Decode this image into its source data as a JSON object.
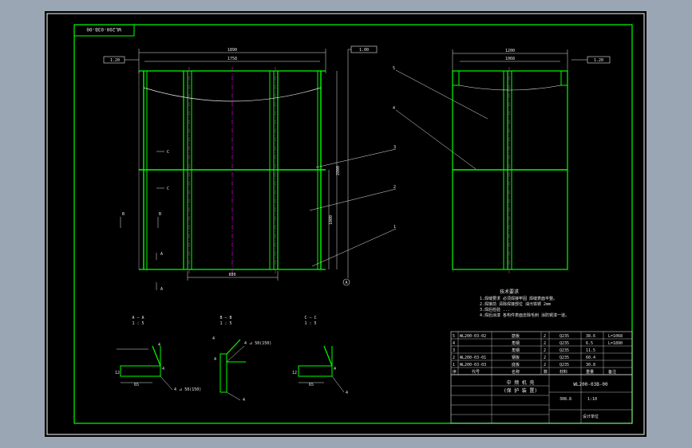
{
  "drawing": {
    "corner_code": "WL200-03B-00",
    "views": {
      "front": {
        "overall_width": "1890",
        "inner_width": "1758",
        "height": "2800",
        "lower_height": "1000",
        "bottom_width": "880",
        "flatness_left": "1.20",
        "flatness_right": "1.00",
        "datum": "A",
        "datum_circle": "A",
        "section_marks": [
          "C",
          "C",
          "B",
          "B",
          "A",
          "A"
        ]
      },
      "side": {
        "overall_width": "1200",
        "inner_width": "1068",
        "flatness": "1.20",
        "datum": "A"
      }
    },
    "leaders": [
      "5",
      "4",
      "3",
      "2",
      "1"
    ],
    "sections": [
      {
        "title": "A — A",
        "scale": "1 : 5",
        "dim1": "65",
        "dim2": "12",
        "dim3": "4",
        "weld": "4 ⊿ 50(150)",
        "extra": "4"
      },
      {
        "title": "B — B",
        "scale": "1 : 5",
        "weld": "4 ⊿ 50(150)",
        "dim1": "4",
        "dim2": "4",
        "extra": "4"
      },
      {
        "title": "C — C",
        "scale": "1 : 5",
        "dim1": "65",
        "dim2": "12",
        "dim3": "4",
        "extra": "4"
      }
    ],
    "notes": {
      "title": "技术要求",
      "lines": [
        "1.焊缝要求 必须焊接牢固 焊缝表面平整。",
        "2.焊接前 清除焊接部位 油污铁锈 2mm",
        "3.焊后检验 ...",
        "4.焊后涂漆 各构件表面去除毛刺 涂防锈漆一道。"
      ]
    },
    "bom": {
      "rows": [
        {
          "no": "5",
          "code": "WL200-03-02",
          "name": "筋板",
          "qty": "2",
          "material": "Q235",
          "weight": "38.6",
          "remark": "L=1068"
        },
        {
          "no": "4",
          "code": "",
          "name": "角钢",
          "qty": "2",
          "material": "Q235",
          "weight": "6.5",
          "remark": "L=1890"
        },
        {
          "no": "3",
          "code": "",
          "name": "角钢",
          "qty": "2",
          "material": "Q235",
          "weight": "11.5",
          "remark": ""
        },
        {
          "no": "2",
          "code": "WL200-03-01",
          "name": "钢板",
          "qty": "2",
          "material": "Q235",
          "weight": "60.4",
          "remark": ""
        },
        {
          "no": "1",
          "code": "WL200-03-03",
          "name": "底板",
          "qty": "2",
          "material": "Q235",
          "weight": "30.8",
          "remark": ""
        }
      ],
      "header": [
        "序",
        "代号",
        "名称",
        "数",
        "材料",
        "重量",
        "备注"
      ]
    },
    "title_block": {
      "project_line1": "中 频 机 壳",
      "project_line2": "(保 护 装 置)",
      "code": "WL200-03B-00",
      "weight": "308.8",
      "scale": "1:10",
      "company": "设计单位"
    }
  }
}
